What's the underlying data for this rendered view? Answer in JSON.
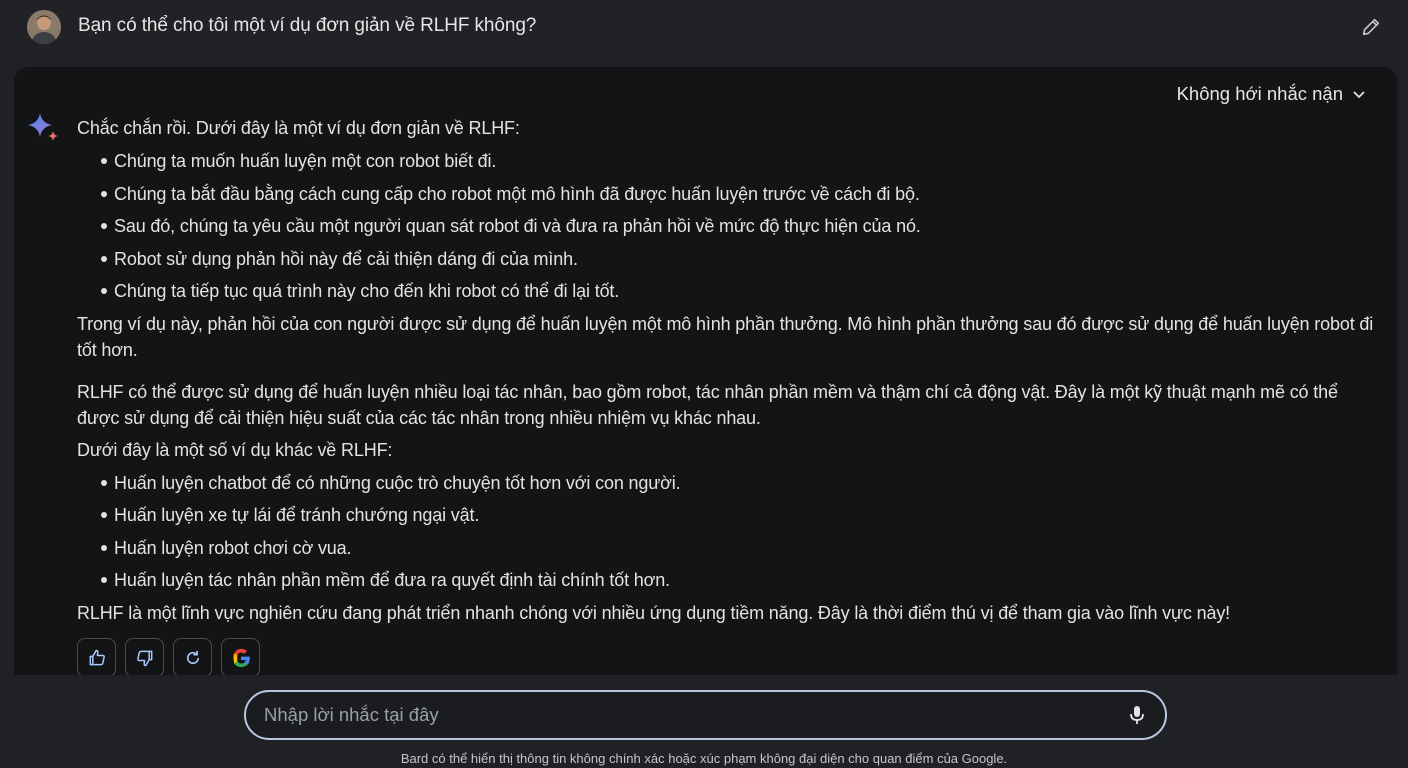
{
  "prompt": {
    "text": "Bạn có thể cho tôi một ví dụ đơn giản về RLHF không?"
  },
  "response": {
    "drafts_label": "Không hới nhắc nận",
    "intro": "Chắc chắn rồi. Dưới đây là một ví dụ đơn giản về RLHF:",
    "steps": [
      "Chúng ta muốn huấn luyện một con robot biết đi.",
      "Chúng ta bắt đầu bằng cách cung cấp cho robot một mô hình đã được huấn luyện trước về cách đi bộ.",
      "Sau đó, chúng ta yêu cầu một người quan sát robot đi và đưa ra phản hồi về mức độ thực hiện của nó.",
      "Robot sử dụng phản hồi này để cải thiện dáng đi của mình.",
      "Chúng ta tiếp tục quá trình này cho đến khi robot có thể đi lại tốt."
    ],
    "explanation": "Trong ví dụ này, phản hồi của con người được sử dụng để huấn luyện một mô hình phần thưởng. Mô hình phần thưởng sau đó được sử dụng để huấn luyện robot đi tốt hơn.",
    "paragraph2": "RLHF có thể được sử dụng để huấn luyện nhiều loại tác nhân, bao gồm robot, tác nhân phần mềm và thậm chí cả động vật. Đây là một kỹ thuật mạnh mẽ có thể được sử dụng để cải thiện hiệu suất của các tác nhân trong nhiều nhiệm vụ khác nhau.",
    "examples_intro": "Dưới đây là một số ví dụ khác về RLHF:",
    "examples": [
      "Huấn luyện chatbot để có những cuộc trò chuyện tốt hơn với con người.",
      "Huấn luyện xe tự lái để tránh chướng ngại vật.",
      "Huấn luyện robot chơi cờ vua.",
      "Huấn luyện tác nhân phần mềm để đưa ra quyết định tài chính tốt hơn."
    ],
    "conclusion": "RLHF là một lĩnh vực nghiên cứu đang phát triển nhanh chóng với nhiều ứng dụng tiềm năng. Đây là thời điểm thú vị để tham gia vào lĩnh vực này!"
  },
  "actions": {
    "icons": [
      "thumbs-up-icon",
      "thumbs-down-icon",
      "regenerate-icon",
      "google-icon"
    ]
  },
  "input": {
    "placeholder": "Nhập lời nhắc tại đây"
  },
  "footer": {
    "disclaimer": "Bard có thể hiển thị thông tin không chính xác hoặc xúc phạm không đại diện cho quan điểm của Google."
  },
  "colors": {
    "background": "#1f2125",
    "card": "#131416",
    "input_border": "#b8c7e0",
    "spark_blue": "#4f8df7",
    "spark_red": "#e8716b"
  }
}
